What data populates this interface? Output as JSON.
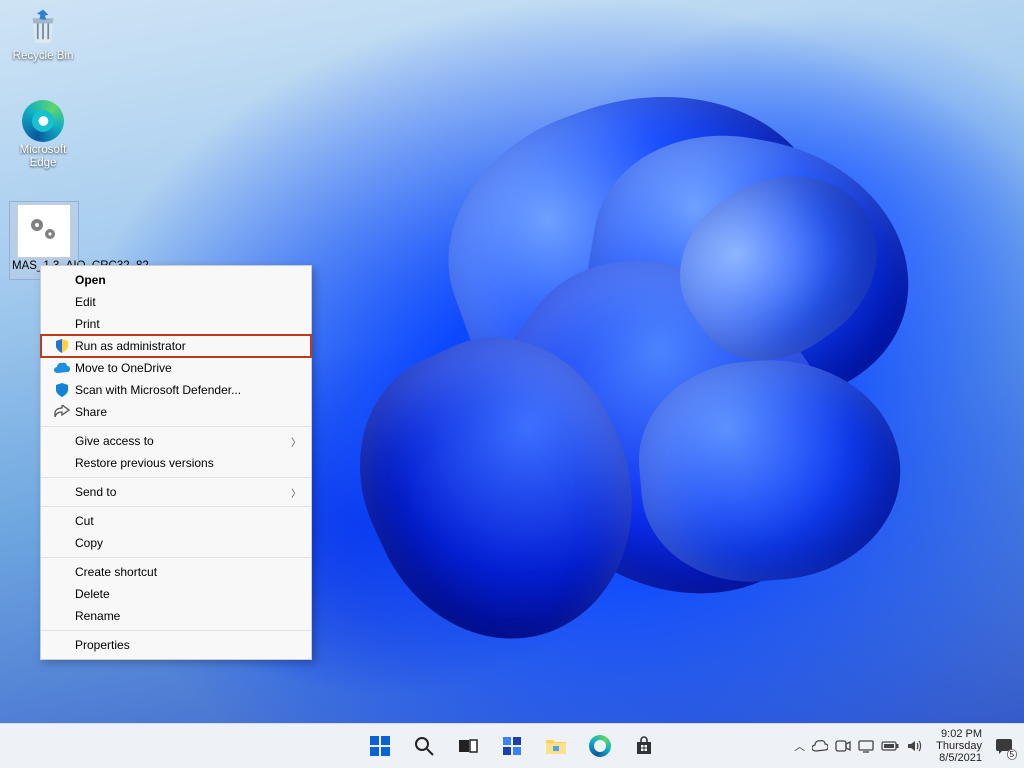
{
  "desktop_icons": {
    "recycle_bin": "Recycle Bin",
    "edge": "Microsoft Edge",
    "cmd_file": "MAS_1.3_AIO_CRC32_82…"
  },
  "context_menu": {
    "open": "Open",
    "edit": "Edit",
    "print": "Print",
    "run_admin": "Run as administrator",
    "onedrive": "Move to OneDrive",
    "defender": "Scan with Microsoft Defender...",
    "share": "Share",
    "give_access": "Give access to",
    "restore_prev": "Restore previous versions",
    "send_to": "Send to",
    "cut": "Cut",
    "copy": "Copy",
    "create_shortcut": "Create shortcut",
    "delete": "Delete",
    "rename": "Rename",
    "properties": "Properties"
  },
  "taskbar": {
    "start": "Start",
    "search": "Search",
    "taskview": "Task View",
    "widgets": "Widgets",
    "explorer": "File Explorer",
    "edge": "Microsoft Edge",
    "store": "Microsoft Store"
  },
  "tray": {
    "chevron": "Show hidden icons",
    "onedrive": "OneDrive",
    "meetnow": "Meet Now",
    "network": "Network",
    "battery": "Battery",
    "volume": "Volume"
  },
  "clock": {
    "time": "9:02 PM",
    "day": "Thursday",
    "date": "8/5/2021"
  },
  "notification_count": "5"
}
